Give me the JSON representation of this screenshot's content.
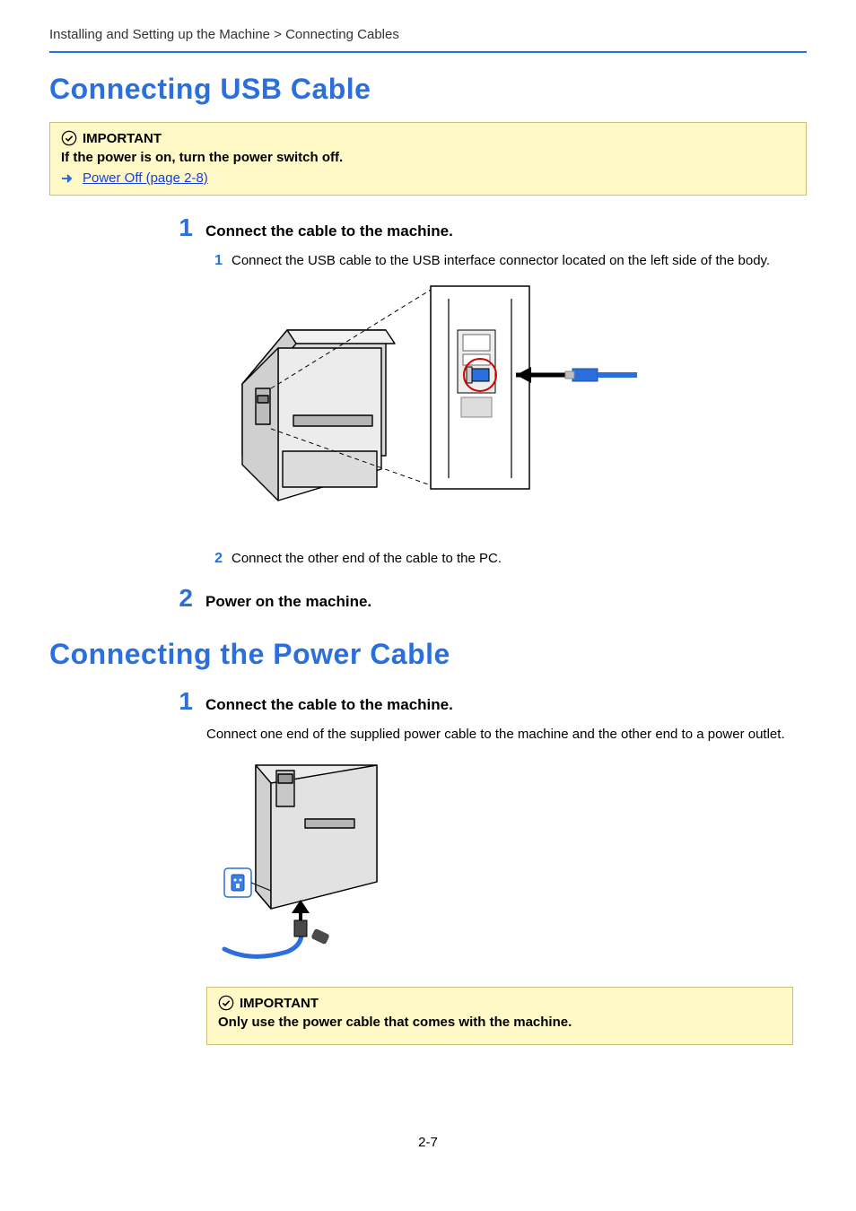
{
  "breadcrumb": "Installing and Setting up the Machine > Connecting Cables",
  "section1": {
    "title": "Connecting USB Cable",
    "important_label": "IMPORTANT",
    "important_body": "If the power is on, turn the power switch off.",
    "link_text": "Power Off (page 2-8)",
    "step1_num": "1",
    "step1_title": "Connect the cable to the machine.",
    "step1_sub1_num": "1",
    "step1_sub1_text": "Connect the USB cable to the USB interface connector located on the left side of the body.",
    "step1_sub2_num": "2",
    "step1_sub2_text": "Connect the other end of the cable to the PC.",
    "step2_num": "2",
    "step2_title": "Power on the machine."
  },
  "section2": {
    "title": "Connecting the Power Cable",
    "step1_num": "1",
    "step1_title": "Connect the cable to the machine.",
    "step1_body": "Connect one end of the supplied power cable to the machine and the other end to a power outlet.",
    "important_label": "IMPORTANT",
    "important_body": "Only use the power cable that comes with the machine."
  },
  "page_number": "2-7",
  "icons": {
    "check": "check-icon",
    "arrow": "arrow-icon"
  }
}
